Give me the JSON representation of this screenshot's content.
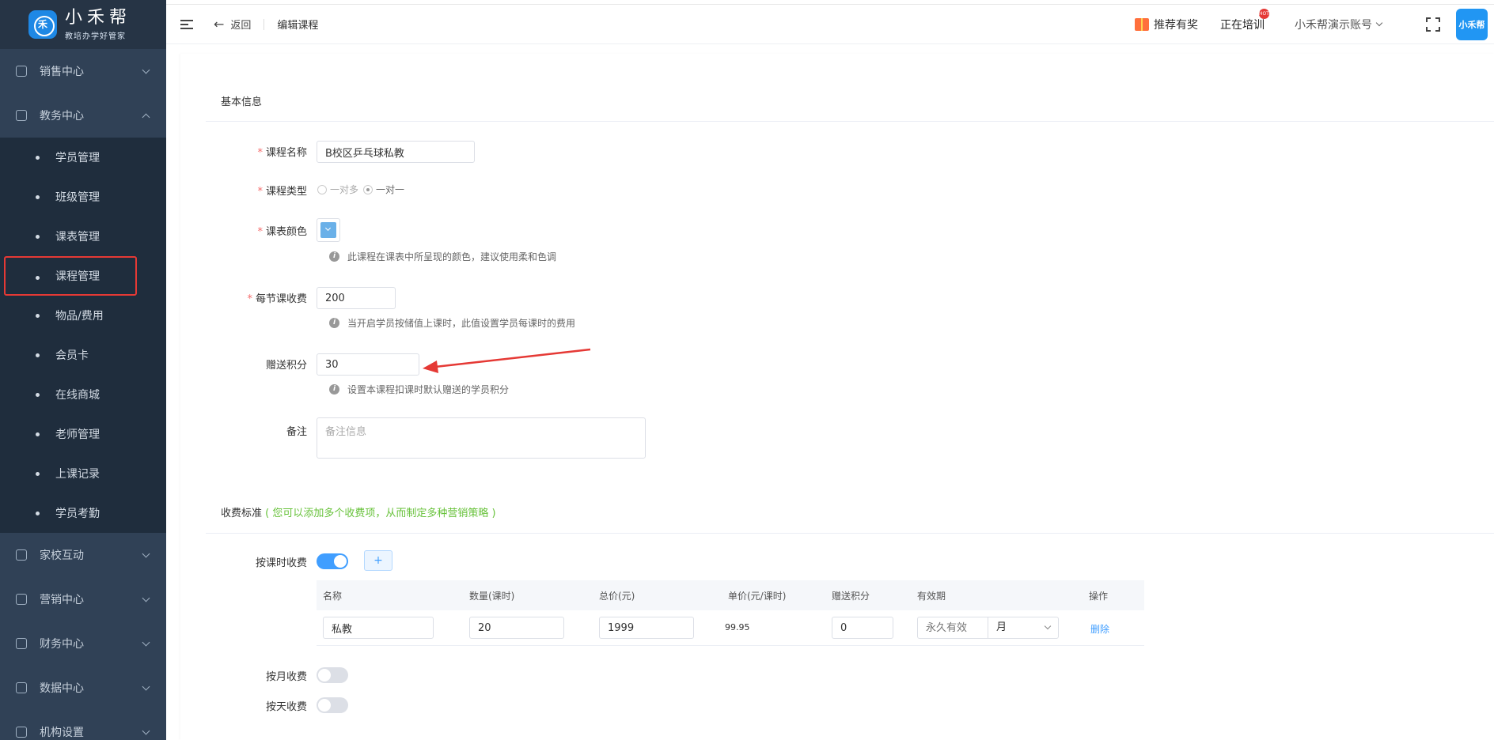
{
  "logo": {
    "title": "小禾帮",
    "subtitle": "教培办学好管家"
  },
  "sidebar": {
    "top_before": [
      {
        "label": "销售中心"
      },
      {
        "label": "教务中心"
      }
    ],
    "sub": [
      {
        "label": "学员管理"
      },
      {
        "label": "班级管理"
      },
      {
        "label": "课表管理"
      },
      {
        "label": "课程管理"
      },
      {
        "label": "物品/费用"
      },
      {
        "label": "会员卡"
      },
      {
        "label": "在线商城"
      },
      {
        "label": "老师管理"
      },
      {
        "label": "上课记录"
      },
      {
        "label": "学员考勤"
      }
    ],
    "top_after": [
      {
        "label": "家校互动"
      },
      {
        "label": "营销中心"
      },
      {
        "label": "财务中心"
      },
      {
        "label": "数据中心"
      },
      {
        "label": "机构设置"
      }
    ]
  },
  "header": {
    "back": "返回",
    "crumb": "编辑课程",
    "recommend": "推荐有奖",
    "training": "正在培训",
    "hot_badge": "HOT",
    "account": "小禾帮演示账号",
    "avatar_text": "小禾帮"
  },
  "basic": {
    "section_title": "基本信息",
    "name_label": "课程名称",
    "name_value": "B校区乒乓球私教",
    "type_label": "课程类型",
    "type_options": [
      "一对多",
      "一对一"
    ],
    "color_label": "课表颜色",
    "color_value": "#6ab0e8",
    "color_hint": "此课程在课表中所呈现的颜色，建议使用柔和色调",
    "fee_label": "每节课收费",
    "fee_value": "200",
    "fee_hint": "当开启学员按储值上课时，此值设置学员每课时的费用",
    "points_label": "赠送积分",
    "points_value": "30",
    "points_hint": "设置本课程扣课时默认赠送的学员积分",
    "remark_label": "备注",
    "remark_placeholder": "备注信息"
  },
  "charging": {
    "section_title": "收费标准",
    "section_note": "( 您可以添加多个收费项，从而制定多种营销策略 )",
    "by_lesson_label": "按课时收费",
    "by_lesson_on": true,
    "add_button": "+",
    "columns": [
      "名称",
      "数量(课时)",
      "总价(元)",
      "单价(元/课时)",
      "赠送积分",
      "有效期",
      "操作"
    ],
    "row": {
      "name": "私教",
      "quantity": "20",
      "total": "1999",
      "unit_price": "99.95",
      "points": "0",
      "validity_placeholder": "永久有效",
      "validity_unit": "月",
      "action": "删除"
    },
    "by_month_label": "按月收费",
    "by_month_on": false,
    "by_day_label": "按天收费",
    "by_day_on": false
  },
  "colors": {
    "sidebar_bg": "#304156",
    "primary": "#409eff",
    "required": "#f56c6c",
    "highlight_border": "#e53935"
  }
}
